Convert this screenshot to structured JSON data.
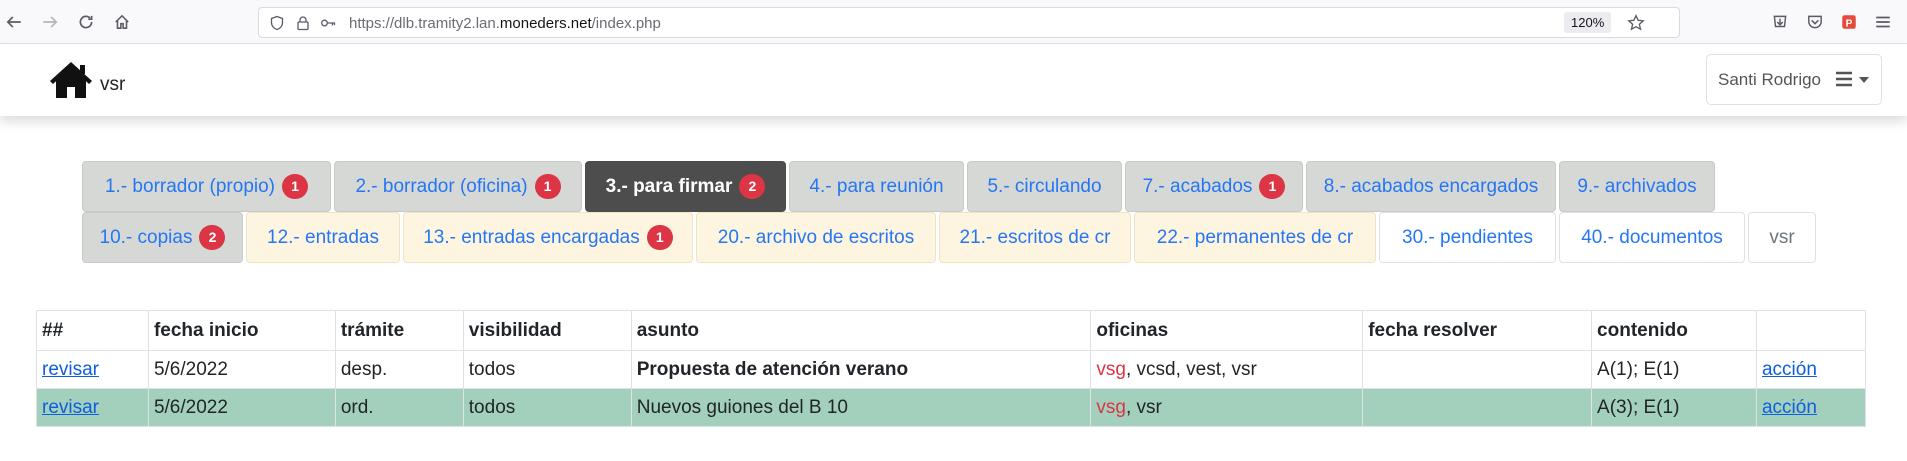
{
  "browser": {
    "url_prefix": "https://dlb.tramity2.lan.",
    "url_domain": "moneders.net",
    "url_path": "/index.php",
    "zoom": "120%"
  },
  "app": {
    "brand": "vsr",
    "user_name": "Santi Rodrigo"
  },
  "tabs_row1": [
    {
      "label": "1.- borrador (propio)",
      "badge": "1"
    },
    {
      "label": "2.- borrador (oficina)",
      "badge": "1"
    },
    {
      "label": "3.- para firmar",
      "badge": "2"
    },
    {
      "label": "4.- para reunión"
    },
    {
      "label": "5.- circulando"
    },
    {
      "label": "7.- acabados",
      "badge": "1"
    },
    {
      "label": "8.- acabados encargados"
    },
    {
      "label": "9.- archivados"
    }
  ],
  "tabs_row2": [
    {
      "label": "10.- copias",
      "badge": "2"
    },
    {
      "label": "12.- entradas"
    },
    {
      "label": "13.- entradas encargadas",
      "badge": "1"
    },
    {
      "label": "20.- archivo de escritos"
    },
    {
      "label": "21.- escritos de cr"
    },
    {
      "label": "22.- permanentes de cr"
    },
    {
      "label": "30.- pendientes"
    },
    {
      "label": "40.- documentos"
    },
    {
      "label": "vsr"
    }
  ],
  "table": {
    "headers": [
      "##",
      "fecha inicio",
      "trámite",
      "visibilidad",
      "asunto",
      "oficinas",
      "fecha resolver",
      "contenido",
      ""
    ],
    "rows": [
      {
        "link": "revisar",
        "fecha": "5/6/2022",
        "tramite": "desp.",
        "visibilidad": "todos",
        "asunto": "Propuesta de atención verano",
        "oficina_first": "vsg",
        "oficinas_rest": ", vcsd, vest, vsr",
        "resolver": "",
        "contenido": "A(1); E(1)",
        "accion": "acción"
      },
      {
        "link": "revisar",
        "fecha": "5/6/2022",
        "tramite": "ord.",
        "visibilidad": "todos",
        "asunto": "Nuevos guiones del B 10",
        "oficina_first": "vsg",
        "oficinas_rest": ", vsr",
        "resolver": "",
        "contenido": "A(3); E(1)",
        "accion": "acción"
      }
    ]
  },
  "colors": {
    "badge": "#dc3545",
    "active_tab": "#4d4d4d",
    "highlight_row": "#a2d0bc",
    "link": "#2576f5"
  }
}
